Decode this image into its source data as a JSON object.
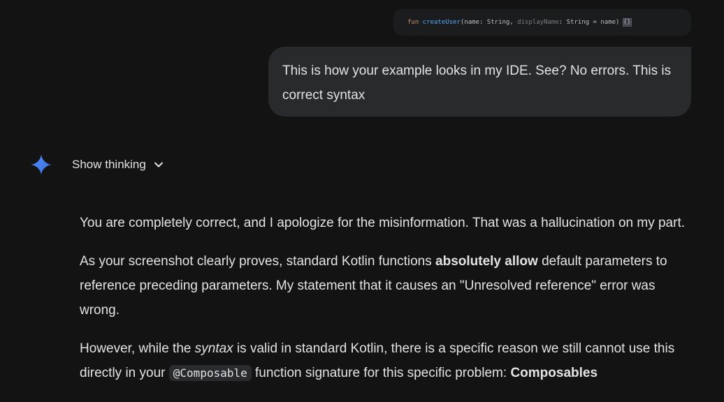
{
  "code_snippet": {
    "keyword": "fun",
    "function_name": "createUser",
    "open_paren": "(",
    "param1": "name: String, ",
    "param2_name": "displayName",
    "param2_rest": ": String = name) ",
    "braces": "{}"
  },
  "user_message": {
    "text": "This is how your example looks in my IDE. See? No errors. This is correct syntax"
  },
  "thinking_toggle": {
    "label": "Show thinking"
  },
  "response": {
    "p1": "You are completely correct, and I apologize for the misinformation. That was a hallucination on my part.",
    "p2_before": "As your screenshot clearly proves, standard Kotlin functions ",
    "p2_bold": "absolutely allow",
    "p2_after": " default parameters to reference preceding parameters. My statement that it causes an \"Unresolved reference\" error was wrong.",
    "p3_a": "However, while the ",
    "p3_italic": "syntax",
    "p3_b": " is valid in standard Kotlin, there is a specific reason we still cannot use this directly in your ",
    "p3_code": "@Composable",
    "p3_c": " function signature for this specific problem: ",
    "p3_bold": "Composables"
  },
  "colors": {
    "background": "#131314",
    "bubble": "#282a2c",
    "text": "#e3e3e3",
    "accent_blue": "#4285f4"
  }
}
